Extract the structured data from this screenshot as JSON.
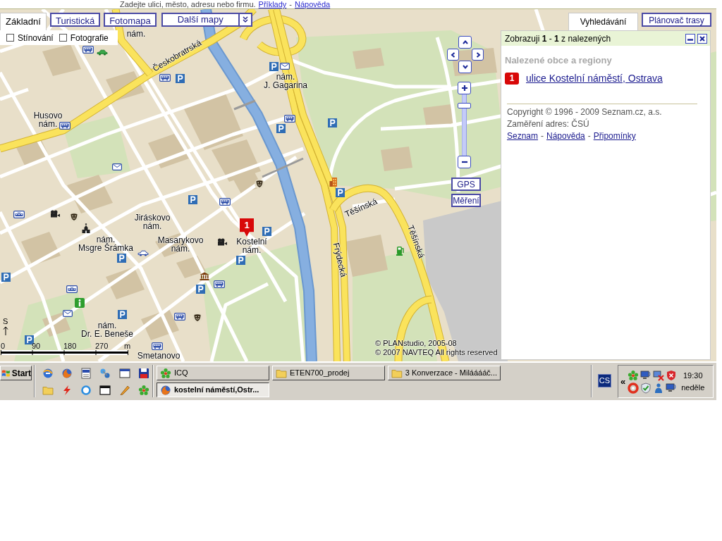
{
  "header": {
    "prompt": "Zadejte ulici, město, adresu nebo firmu.",
    "links": [
      {
        "kind": "link",
        "text": "Příklady"
      },
      {
        "kind": "separator",
        "text": "-"
      },
      {
        "kind": "link",
        "text": "Nápověda"
      }
    ]
  },
  "map_tabs": [
    {
      "kind": "tab",
      "label": "Základní",
      "selected": true
    },
    {
      "kind": "tab",
      "label": "Turistická",
      "selected": false
    },
    {
      "kind": "tab",
      "label": "Fotomapa",
      "selected": false
    },
    {
      "kind": "dropdown",
      "label": "Další mapy",
      "selected": false
    }
  ],
  "layers": [
    {
      "label": "Stínování",
      "checked": false
    },
    {
      "label": "Fotografie",
      "checked": false
    }
  ],
  "panel_tabs": [
    {
      "label": "Vyhledávání",
      "selected": true
    },
    {
      "label": "Plánovač trasy",
      "selected": false
    }
  ],
  "results": {
    "summary": "Zobrazuji **1** - **1** z nalezených",
    "heading": "Nalezené obce a regiony",
    "items": [
      {
        "number": "1",
        "label": "ulice Kostelní náměstí, Ostrava"
      }
    ],
    "copyright": "Copyright © 1996 - 2009 Seznam.cz, a.s.",
    "source": "Zaměření adres: ČSÚ",
    "links": [
      {
        "kind": "link",
        "text": "Seznam"
      },
      {
        "kind": "separator",
        "text": "-"
      },
      {
        "kind": "link",
        "text": "Nápověda"
      },
      {
        "kind": "separator",
        "text": "-"
      },
      {
        "kind": "link",
        "text": "Připomínky"
      }
    ]
  },
  "map": {
    "labels": [
      {
        "kind": "place",
        "lines": [
          "nám."
        ]
      },
      {
        "kind": "street",
        "lines": [
          "Českobratrská"
        ]
      },
      {
        "kind": "place",
        "lines": [
          "nám.",
          "J. Gagarina"
        ]
      },
      {
        "kind": "place",
        "lines": [
          "Husovo",
          "nám."
        ]
      },
      {
        "kind": "place",
        "lines": [
          "Jiráskovo",
          "nám."
        ]
      },
      {
        "kind": "place",
        "lines": [
          "nám.",
          "Msgre Šrámka"
        ]
      },
      {
        "kind": "place",
        "lines": [
          "Masarykovo",
          "nám."
        ]
      },
      {
        "kind": "place",
        "lines": [
          "Kostelní",
          "nám."
        ]
      },
      {
        "kind": "street",
        "lines": [
          "Těšínská"
        ]
      },
      {
        "kind": "street",
        "lines": [
          "Frýdecká"
        ]
      },
      {
        "kind": "street",
        "lines": [
          "Těšínská"
        ]
      },
      {
        "kind": "place",
        "lines": [
          "nám.",
          "Dr. E. Beneše"
        ]
      },
      {
        "kind": "place",
        "lines": [
          "Smetanovo"
        ]
      }
    ],
    "pin": "1",
    "zoom_slider": {
      "level": 0.85
    },
    "buttons": [
      "GPS",
      "Měření"
    ],
    "north": "S",
    "scale": [
      "0",
      "90",
      "180",
      "270",
      "m"
    ],
    "attribution": [
      "© PLANstudio, 2005-08",
      "© 2007 NAVTEQ All rights reserved"
    ]
  },
  "taskbar": {
    "start": "Start",
    "tasks": [
      {
        "label": "ICQ",
        "selected": false
      },
      {
        "label": "ETEN700_prodej",
        "selected": false
      },
      {
        "label": "3 Konverzace - Milááááč...",
        "selected": false
      },
      {
        "label": "kostelní náměstí,Ostr...",
        "selected": true
      }
    ],
    "language": "CS",
    "tray_toggle": "«",
    "time": "19:30",
    "day": "neděle"
  }
}
